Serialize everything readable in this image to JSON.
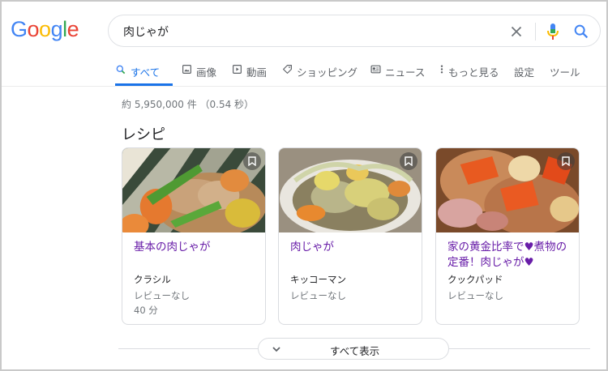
{
  "logo": [
    "G",
    "o",
    "o",
    "g",
    "l",
    "e"
  ],
  "logo_colors": [
    "#4285f4",
    "#ea4335",
    "#fbbc05",
    "#4285f4",
    "#34a853",
    "#ea4335"
  ],
  "search": {
    "query": "肉じゃが"
  },
  "tabs": [
    {
      "label": "すべて",
      "icon": "search-icon",
      "active": true
    },
    {
      "label": "画像",
      "icon": "image-icon"
    },
    {
      "label": "動画",
      "icon": "video-icon"
    },
    {
      "label": "ショッピング",
      "icon": "tag-icon"
    },
    {
      "label": "ニュース",
      "icon": "news-icon"
    },
    {
      "label": "もっと見る",
      "icon": "more-vert-icon"
    },
    {
      "label": "設定"
    },
    {
      "label": "ツール"
    }
  ],
  "result_stats": "約 5,950,000 件 （0.54 秒）",
  "recipes": {
    "heading": "レシピ",
    "cards": [
      {
        "title": "基本の肉じゃが",
        "source": "クラシル",
        "reviews": "レビューなし",
        "time": "40 分"
      },
      {
        "title": "肉じゃが",
        "source": "キッコーマン",
        "reviews": "レビューなし"
      },
      {
        "title": "家の黄金比率で♥煮物の定番！肉じゃが♥",
        "source": "クックパッド",
        "reviews": "レビューなし"
      }
    ],
    "show_all": "すべて表示"
  },
  "colors": {
    "accent": "#1a73e8",
    "link_visited": "#681da8",
    "muted": "#70757a"
  }
}
